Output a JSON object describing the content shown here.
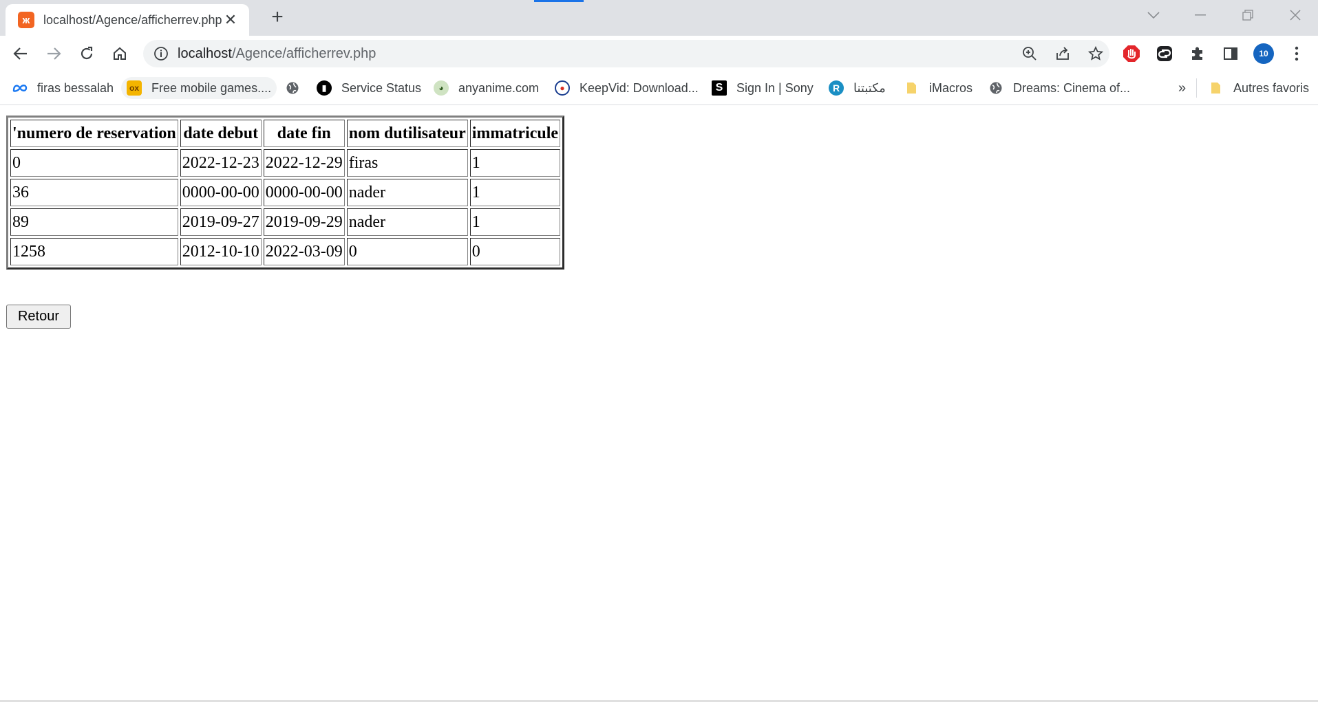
{
  "browser": {
    "tab_title": "localhost/Agence/afficherrev.php",
    "url_host": "localhost",
    "url_path": "/Agence/afficherrev.php",
    "profile_badge": "10"
  },
  "bookmarks": [
    {
      "label": "firas bessalah",
      "icon": "meta-icon",
      "color": "#1877f2"
    },
    {
      "label": "Free mobile games....",
      "icon": "game-icon",
      "color": "#f4b400"
    },
    {
      "label": "",
      "icon": "globe-icon",
      "color": "#5f6368"
    },
    {
      "label": "Service Status",
      "icon": "service-icon",
      "color": "#000000"
    },
    {
      "label": "anyanime.com",
      "icon": "anime-icon",
      "color": "#4c7a34"
    },
    {
      "label": "KeepVid: Download...",
      "icon": "keepvid-icon",
      "color": "#1a3d8f"
    },
    {
      "label": "Sign In | Sony",
      "icon": "sony-icon",
      "color": "#000000"
    },
    {
      "label": "مكتبتنا",
      "icon": "r-icon",
      "color": "#1a8fc4"
    },
    {
      "label": "iMacros",
      "icon": "folder-icon",
      "color": "#f6d36b"
    },
    {
      "label": "Dreams: Cinema of...",
      "icon": "globe-icon",
      "color": "#5f6368"
    }
  ],
  "bookmarks_more": "»",
  "other_bookmarks": "Autres favoris",
  "table": {
    "headers": [
      "'numero de reservation",
      "date debut",
      "date fin",
      "nom dutilisateur",
      "immatricule"
    ],
    "rows": [
      [
        "0",
        "2022-12-23",
        "2022-12-29",
        "firas",
        "1"
      ],
      [
        "36",
        "0000-00-00",
        "0000-00-00",
        "nader",
        "1"
      ],
      [
        "89",
        "2019-09-27",
        "2019-09-29",
        "nader",
        "1"
      ],
      [
        "1258",
        "2012-10-10",
        "2022-03-09",
        "0",
        "0"
      ]
    ]
  },
  "retour_label": "Retour"
}
